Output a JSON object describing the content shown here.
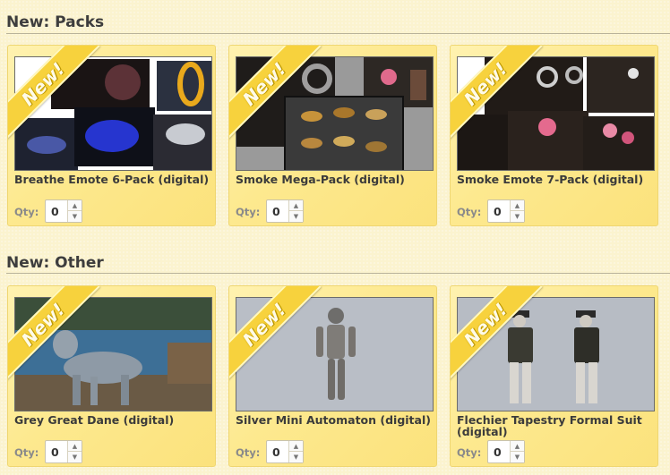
{
  "sections": [
    {
      "title": "New: Packs"
    },
    {
      "title": "New: Other"
    }
  ],
  "ribbon_text": "New!",
  "qty_label": "Qty:",
  "spinner": {
    "up": "▲",
    "down": "▼"
  },
  "products": [
    {
      "name": "Breathe Emote 6-Pack (digital)",
      "qty": "0"
    },
    {
      "name": "Smoke Mega-Pack (digital)",
      "qty": "0"
    },
    {
      "name": "Smoke Emote 7-Pack (digital)",
      "qty": "0"
    },
    {
      "name": "Grey Great Dane (digital)",
      "qty": "0"
    },
    {
      "name": "Silver Mini Automaton (digital)",
      "qty": "0"
    },
    {
      "name": "Flechier Tapestry Formal Suit (digital)",
      "qty": "0"
    }
  ],
  "colors": {
    "background": "#fbf3cf",
    "card": "#fde98f",
    "ribbon": "#f7d23d"
  }
}
